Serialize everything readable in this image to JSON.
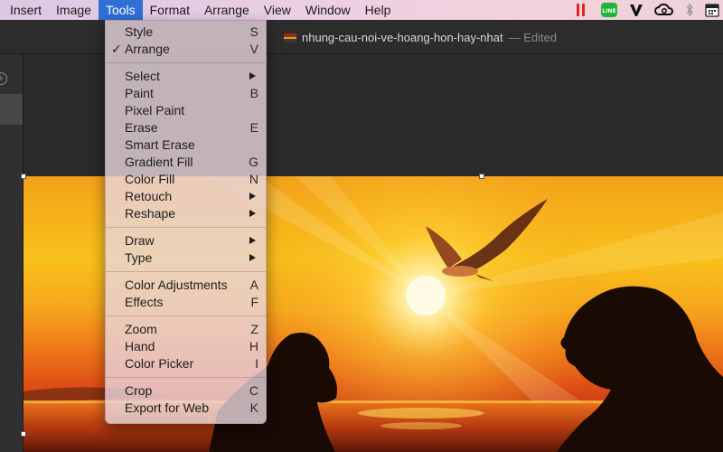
{
  "menubar": {
    "items": [
      "Insert",
      "Image",
      "Tools",
      "Format",
      "Arrange",
      "View",
      "Window",
      "Help"
    ],
    "active_index": 2,
    "status_icons": [
      "parallels-icon",
      "line-icon",
      "vectorize-v-icon",
      "creative-cloud-icon",
      "bluetooth-icon",
      "calendar-icon"
    ]
  },
  "document": {
    "title": "nhung-cau-noi-ve-hoang-hon-hay-nhat",
    "status": "— Edited"
  },
  "tools_menu": {
    "groups": [
      [
        {
          "label": "Style",
          "shortcut": "S"
        },
        {
          "label": "Arrange",
          "shortcut": "V",
          "checked": true
        }
      ],
      [
        {
          "label": "Select",
          "submenu": true
        },
        {
          "label": "Paint",
          "shortcut": "B"
        },
        {
          "label": "Pixel Paint",
          "shortcut": ""
        },
        {
          "label": "Erase",
          "shortcut": "E"
        },
        {
          "label": "Smart Erase",
          "shortcut": ""
        },
        {
          "label": "Gradient Fill",
          "shortcut": "G"
        },
        {
          "label": "Color Fill",
          "shortcut": "N"
        },
        {
          "label": "Retouch",
          "submenu": true
        },
        {
          "label": "Reshape",
          "submenu": true
        }
      ],
      [
        {
          "label": "Draw",
          "submenu": true
        },
        {
          "label": "Type",
          "submenu": true
        }
      ],
      [
        {
          "label": "Color Adjustments",
          "shortcut": "A"
        },
        {
          "label": "Effects",
          "shortcut": "F"
        }
      ],
      [
        {
          "label": "Zoom",
          "shortcut": "Z"
        },
        {
          "label": "Hand",
          "shortcut": "H"
        },
        {
          "label": "Color Picker",
          "shortcut": "I"
        }
      ],
      [
        {
          "label": "Crop",
          "shortcut": "C"
        },
        {
          "label": "Export for Web",
          "shortcut": "K"
        }
      ]
    ]
  },
  "colors": {
    "menubar_active": "#2f6fd6",
    "sun": "#fff6c0",
    "silhouette": "#1a0a04"
  }
}
